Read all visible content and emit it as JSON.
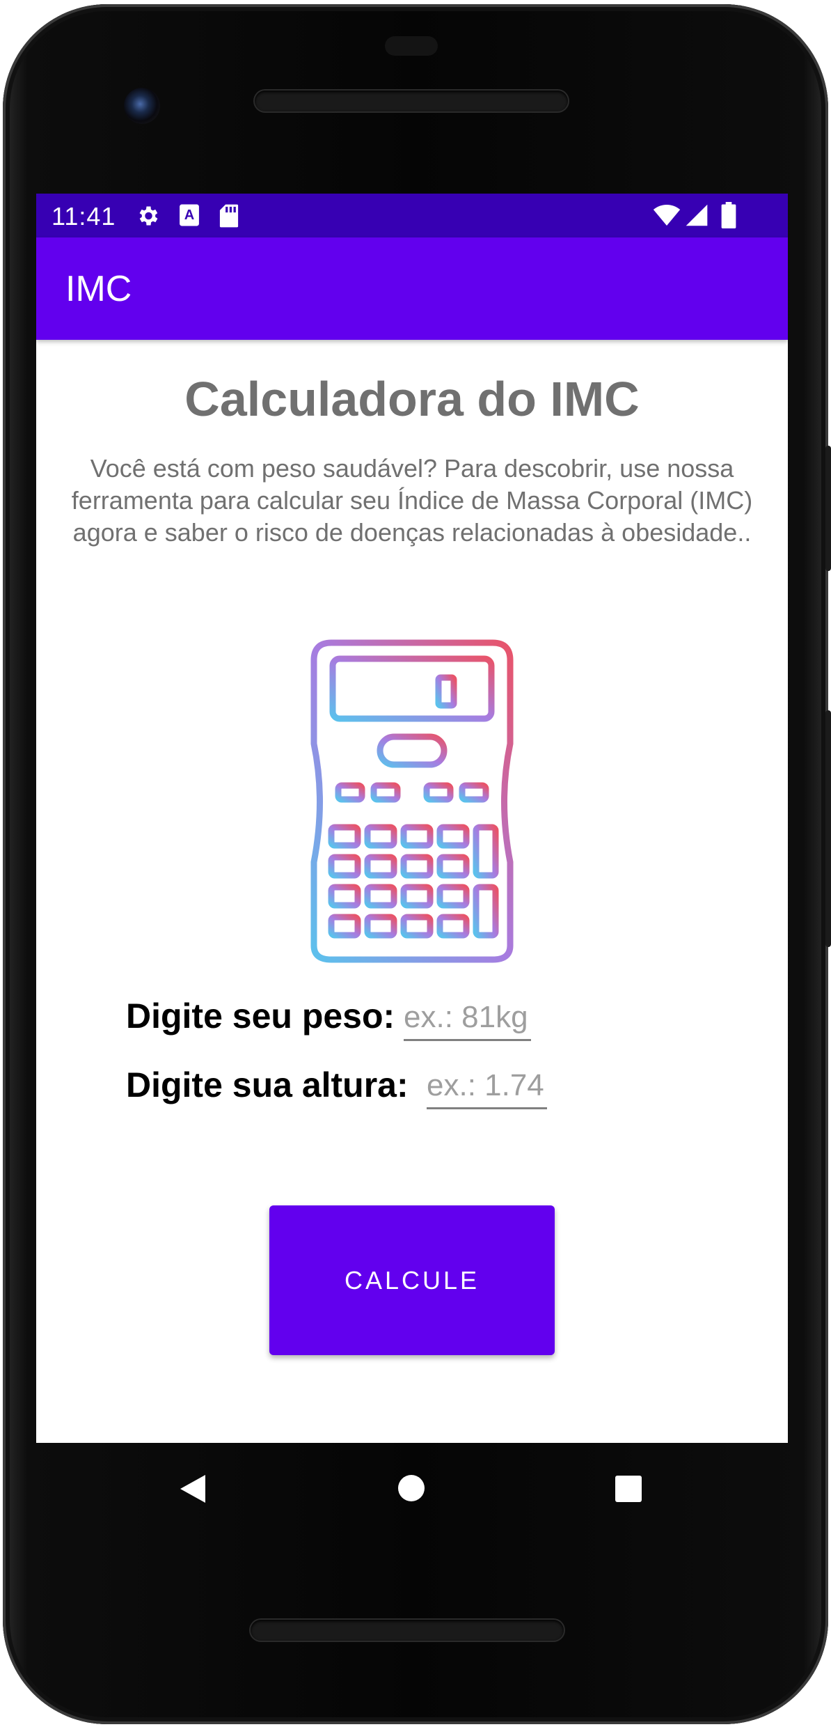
{
  "status_bar": {
    "time": "11:41",
    "left_icons": [
      "gear-icon",
      "keyboard-a-icon",
      "sd-card-icon"
    ],
    "right_icons": [
      "wifi-icon",
      "signal-icon",
      "battery-icon"
    ],
    "color": "#3700b3"
  },
  "app_bar": {
    "title": "IMC",
    "color": "#6200ee"
  },
  "main": {
    "title": "Calculadora do IMC",
    "description": "Você está com peso saudável? Para descobrir, use nossa ferramenta para calcular seu Índice de Massa Corporal (IMC) agora e saber o risco de doenças relacionadas à obesidade..",
    "image_icon": "calculator-icon",
    "weight": {
      "label": "Digite seu peso:",
      "placeholder": "ex.: 81kg",
      "value": ""
    },
    "height": {
      "label": "Digite sua altura:",
      "placeholder": "ex.: 1.74",
      "value": ""
    },
    "button_label": "CALCULE"
  },
  "nav_bar": {
    "items": [
      "back-icon",
      "home-icon",
      "recents-icon"
    ]
  }
}
